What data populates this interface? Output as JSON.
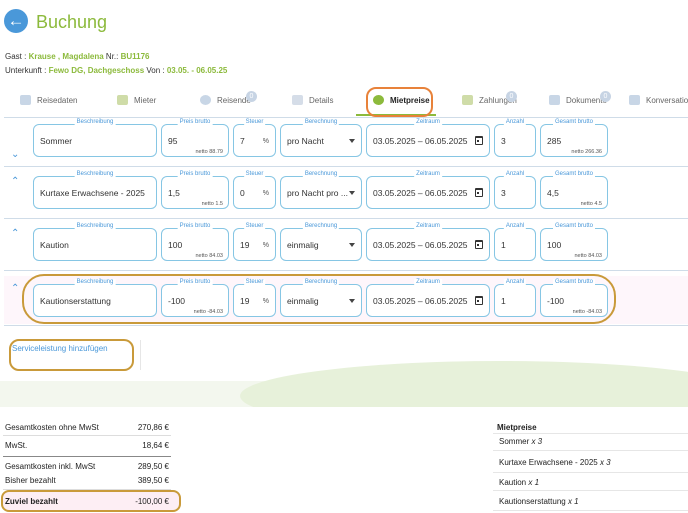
{
  "header": {
    "back_icon": "arrow-left-icon",
    "title": "Buchung"
  },
  "guest": {
    "label": "Gast : ",
    "name": "Krause , Magdalena",
    "nr_label": " Nr.: ",
    "nr": "BU1176"
  },
  "stay": {
    "label": "Unterkunft : ",
    "unit": "Fewo DG, Dachgeschoss",
    "von_label": " Von : ",
    "dates": "03.05. - 06.05.25"
  },
  "tabs": [
    {
      "label": "Reisedaten",
      "icon": "car-icon"
    },
    {
      "label": "Mieter",
      "icon": "id-card-icon"
    },
    {
      "label": "Reisende",
      "icon": "people-icon",
      "badge": "0"
    },
    {
      "label": "Details",
      "icon": "list-icon"
    },
    {
      "label": "Mietpreise",
      "icon": "coins-icon"
    },
    {
      "label": "Zahlungen",
      "icon": "money-icon",
      "badge": "0"
    },
    {
      "label": "Dokumente",
      "icon": "document-icon",
      "badge": "0"
    },
    {
      "label": "Konversatio",
      "icon": "chat-icon"
    }
  ],
  "field_labels": {
    "beschreibung": "Beschreibung",
    "preis": "Preis brutto",
    "steuer": "Steuer",
    "berechnung": "Berechnung",
    "zeitraum": "Zeitraum",
    "anzahl": "Anzahl",
    "gesamt": "Gesamt brutto",
    "percent": "%"
  },
  "items": [
    {
      "beschreibung": "Sommer",
      "preis": "95",
      "preis_netto": "netto 88.79",
      "steuer": "7",
      "berechnung": "pro Nacht",
      "zeitraum": "03.05.2025 – 06.05.2025",
      "anzahl": "3",
      "gesamt": "285",
      "gesamt_netto": "netto 266.36"
    },
    {
      "beschreibung": "Kurtaxe Erwachsene - 2025",
      "preis": "1,5",
      "preis_netto": "netto 1.5",
      "steuer": "0",
      "berechnung": "pro Nacht pro ...",
      "zeitraum": "03.05.2025 – 06.05.2025",
      "anzahl": "3",
      "gesamt": "4,5",
      "gesamt_netto": "netto 4.5"
    },
    {
      "beschreibung": "Kaution",
      "preis": "100",
      "preis_netto": "netto 84.03",
      "steuer": "19",
      "berechnung": "einmalig",
      "zeitraum": "03.05.2025 – 06.05.2025",
      "anzahl": "1",
      "gesamt": "100",
      "gesamt_netto": "netto 84.03"
    },
    {
      "beschreibung": "Kautionserstattung",
      "preis": "-100",
      "preis_netto": "netto -84.03",
      "steuer": "19",
      "berechnung": "einmalig",
      "zeitraum": "03.05.2025 – 06.05.2025",
      "anzahl": "1",
      "gesamt": "-100",
      "gesamt_netto": "netto -84.03"
    }
  ],
  "add_service": "Serviceleistung hinzufügen",
  "totals": [
    {
      "label": "Gesamtkosten ohne MwSt",
      "value": "270,86 €"
    },
    {
      "label": "MwSt.",
      "value": "18,64 €"
    },
    {
      "label": "Gesamtkosten inkl. MwSt",
      "value": "289,50 €"
    },
    {
      "label": "Bisher bezahlt",
      "value": "389,50 €"
    },
    {
      "label": "Zuviel bezahlt",
      "value": "-100,00 €"
    }
  ],
  "mietpreise": {
    "title": "Mietpreise",
    "items": [
      {
        "name": "Sommer ",
        "qty": "x 3"
      },
      {
        "name": "Kurtaxe Erwachsene - 2025 ",
        "qty": "x 3"
      },
      {
        "name": "Kaution ",
        "qty": "x 1"
      },
      {
        "name": "Kautionserstattung ",
        "qty": "x 1"
      }
    ]
  },
  "colors": {
    "accent_green": "#8cba3c",
    "accent_blue": "#4a98d9",
    "highlight_orange": "#e8823a",
    "highlight_gold": "#c99a3a"
  }
}
